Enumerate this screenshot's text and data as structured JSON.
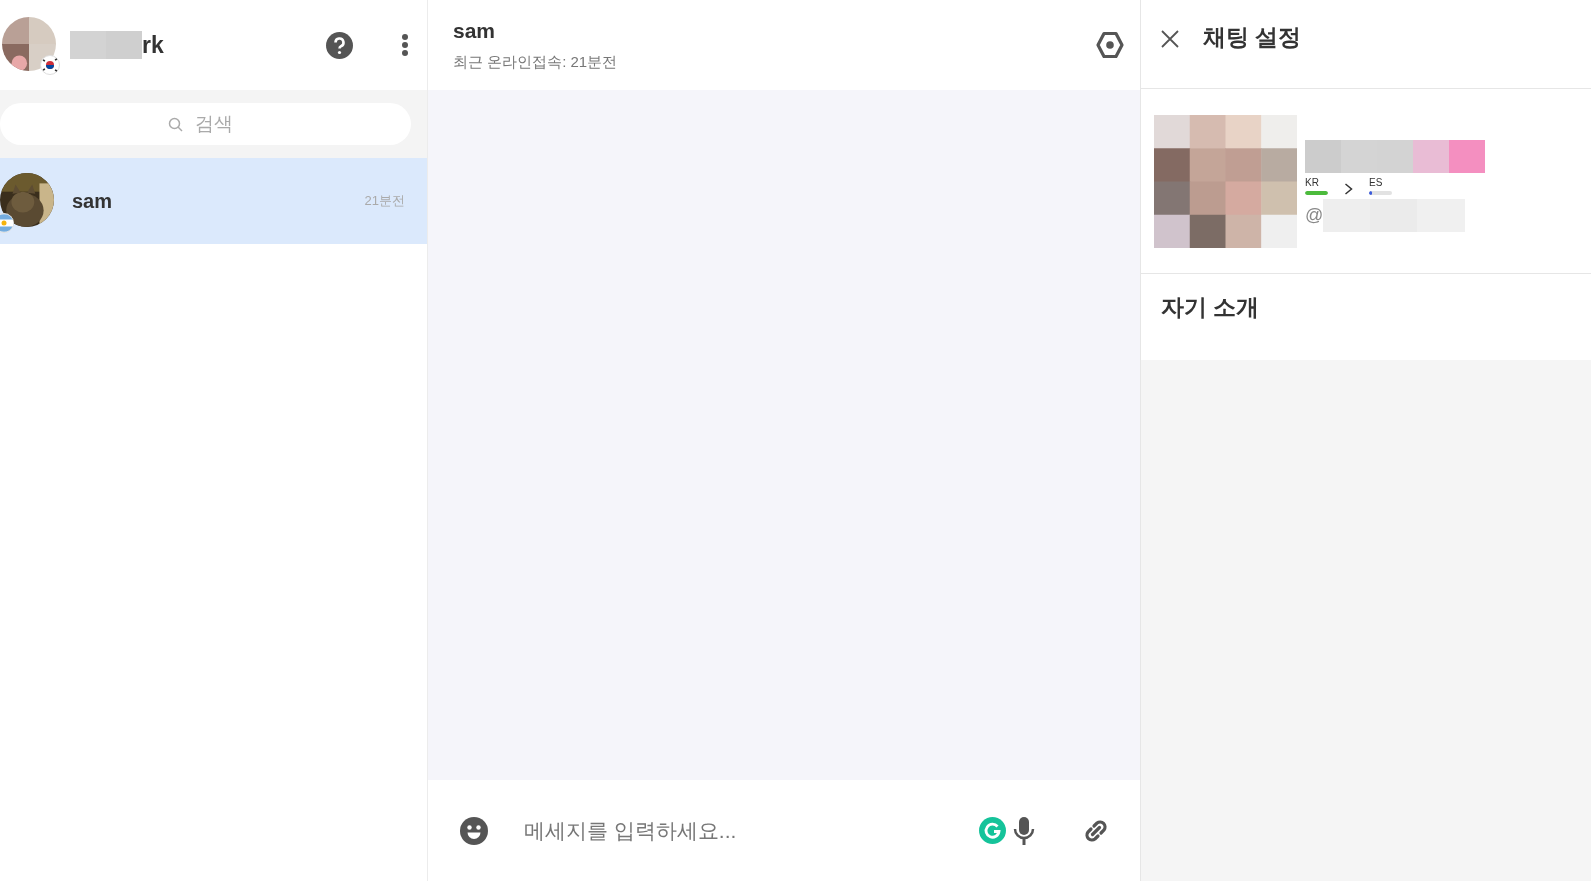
{
  "sidebar": {
    "user": {
      "name": "rk"
    },
    "search": {
      "placeholder": "검색"
    },
    "chats": [
      {
        "name": "sam",
        "time": "21분전",
        "selected": true
      }
    ]
  },
  "chat": {
    "title": "sam",
    "status": "최근 온라인접속: 21분전",
    "composer": {
      "placeholder": "메세지를 입력하세요..."
    }
  },
  "settings_panel": {
    "title": "채팅 설정",
    "profile": {
      "handle_prefix": "@",
      "languages": [
        {
          "code": "KR",
          "level": 1,
          "color": "#4cbb3c"
        },
        {
          "code": "ES",
          "level": 0.12,
          "color": "#3b5bdb"
        }
      ]
    },
    "about_heading": "자기 소개"
  }
}
